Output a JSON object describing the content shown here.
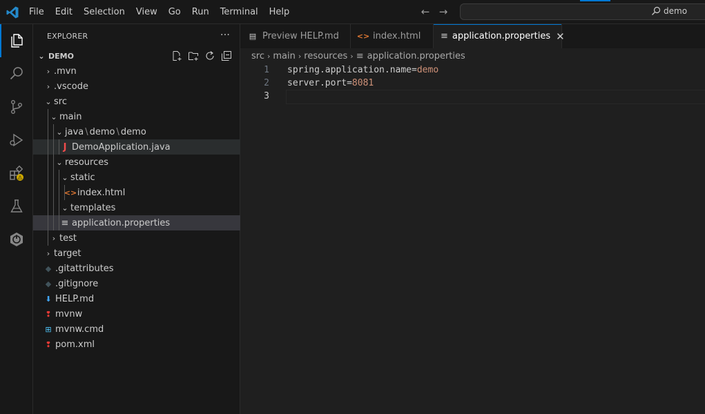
{
  "menu": [
    "File",
    "Edit",
    "Selection",
    "View",
    "Go",
    "Run",
    "Terminal",
    "Help"
  ],
  "search": {
    "query": "demo"
  },
  "sidebar": {
    "title": "EXPLORER",
    "more": "···",
    "folder": "DEMO"
  },
  "tree": [
    {
      "label": ".mvn",
      "twisty": "›",
      "icon": "",
      "depth": 0
    },
    {
      "label": ".vscode",
      "twisty": "›",
      "icon": "",
      "depth": 0
    },
    {
      "label": "src",
      "twisty": "⌄",
      "icon": "",
      "depth": 0
    },
    {
      "label": "main",
      "twisty": "⌄",
      "icon": "",
      "depth": 1
    },
    {
      "label": "java",
      "twisty": "⌄",
      "icon": "",
      "depth": 2,
      "extra": [
        "demo",
        "demo"
      ]
    },
    {
      "label": "DemoApplication.java",
      "twisty": "",
      "icon": "J",
      "icon_color": "#f14c4c",
      "depth": 3,
      "hl": "hl2"
    },
    {
      "label": "resources",
      "twisty": "⌄",
      "icon": "",
      "depth": 2
    },
    {
      "label": "static",
      "twisty": "⌄",
      "icon": "",
      "depth": 3
    },
    {
      "label": "index.html",
      "twisty": "",
      "icon": "<>",
      "icon_color": "#e37933",
      "depth": 4
    },
    {
      "label": "templates",
      "twisty": "⌄",
      "icon": "",
      "depth": 3
    },
    {
      "label": "application.properties",
      "twisty": "",
      "icon": "≡",
      "icon_color": "#cccccc",
      "depth": 3,
      "hl": "hl"
    },
    {
      "label": "test",
      "twisty": "›",
      "icon": "",
      "depth": 1
    },
    {
      "label": "target",
      "twisty": "›",
      "icon": "",
      "depth": 0
    },
    {
      "label": ".gitattributes",
      "twisty": "",
      "icon": "◆",
      "icon_color": "#41535b",
      "depth": 0
    },
    {
      "label": ".gitignore",
      "twisty": "",
      "icon": "◆",
      "icon_color": "#41535b",
      "depth": 0
    },
    {
      "label": "HELP.md",
      "twisty": "",
      "icon": "⬇",
      "icon_color": "#42a5f5",
      "depth": 0
    },
    {
      "label": "mvnw",
      "twisty": "",
      "icon": "❢",
      "icon_color": "#e53935",
      "depth": 0
    },
    {
      "label": "mvnw.cmd",
      "twisty": "",
      "icon": "⊞",
      "icon_color": "#4fc3f7",
      "depth": 0
    },
    {
      "label": "pom.xml",
      "twisty": "",
      "icon": "❢",
      "icon_color": "#e53935",
      "depth": 0
    }
  ],
  "tabs": [
    {
      "label": "Preview HELP.md",
      "icon": "▤",
      "icon_color": "#cccccc",
      "active": false
    },
    {
      "label": "index.html",
      "icon": "<>",
      "icon_color": "#e37933",
      "active": false
    },
    {
      "label": "application.properties",
      "icon": "≡",
      "icon_color": "#cccccc",
      "active": true
    }
  ],
  "breadcrumb": [
    "src",
    "main",
    "resources",
    "application.properties"
  ],
  "code": [
    {
      "num": "1",
      "key": "spring.application.name",
      "eq": "=",
      "val": "demo",
      "type": "str"
    },
    {
      "num": "2",
      "key": "server.port",
      "eq": "=",
      "val": "8081",
      "type": "num"
    },
    {
      "num": "3",
      "key": "",
      "eq": "",
      "val": "",
      "type": ""
    }
  ],
  "colors": {
    "accent": "#0078d4",
    "warning": "#cca700"
  }
}
